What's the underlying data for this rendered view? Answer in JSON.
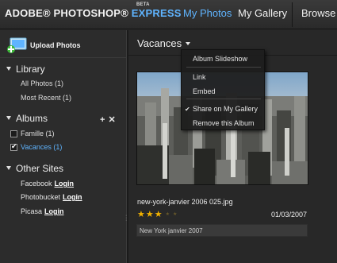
{
  "header": {
    "brand_part1": "ADOBE",
    "brand_reg": "®",
    "brand_part2": "PHOTOSHOP",
    "brand_part3": "EXPRESS",
    "beta": "BETA",
    "nav": {
      "my_photos": "My Photos",
      "my_gallery": "My Gallery",
      "browse": "Browse"
    }
  },
  "sidebar": {
    "upload_label": "Upload Photos",
    "library": {
      "title": "Library",
      "items": [
        "All Photos (1)",
        "Most Recent (1)"
      ]
    },
    "albums": {
      "title": "Albums",
      "add": "+",
      "remove": "✕",
      "items": [
        {
          "label": "Famille (1)",
          "checked": false
        },
        {
          "label": "Vacances (1)",
          "checked": true
        }
      ]
    },
    "other_sites": {
      "title": "Other Sites",
      "link_label": "Login",
      "sites": [
        "Facebook",
        "Photobucket",
        "Picasa"
      ]
    }
  },
  "main": {
    "album_title": "Vacances",
    "photo": {
      "filename": "new-york-janvier 2006 025.jpg",
      "rating": 3,
      "rating_max": 5,
      "date": "01/03/2007",
      "caption": "New York janvier 2007"
    }
  },
  "menu": {
    "items": [
      "Album Slideshow",
      "Link",
      "Embed",
      "Share on My Gallery",
      "Remove this Album"
    ],
    "checked_item": "Share on My Gallery"
  },
  "colors": {
    "accent": "#5fb4ff",
    "star": "#f2b200",
    "background": "#2b2b2b"
  }
}
